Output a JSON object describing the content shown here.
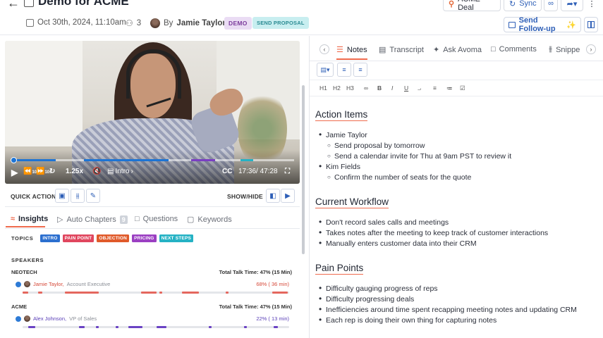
{
  "header": {
    "title": "Demo for ACME",
    "date": "Oct 30th, 2024, 11:10am",
    "attendees": "3",
    "by": "By",
    "owner": "Jamie Taylor",
    "badge_demo": "DEMO",
    "badge_stage": "SEND PROPOSAL",
    "deal_button": "ACME Deal",
    "sync_button": "Sync",
    "followup_button": "Send Follow-up"
  },
  "player": {
    "speed": "1.25x",
    "chapter": "Intro",
    "skip_back": "10s",
    "skip_fwd": "10s",
    "time": "17:36/ 47:28",
    "cc": "CC",
    "progress": 0.01
  },
  "quick_actions": {
    "quick_action_label": "QUICK ACTION",
    "show_hide_label": "SHOW/HIDE"
  },
  "left_tabs": [
    {
      "label": "Insights"
    },
    {
      "label": "Auto Chapters",
      "count": "9"
    },
    {
      "label": "Questions"
    },
    {
      "label": "Keywords"
    }
  ],
  "topics": {
    "label": "TOPICS",
    "items": [
      {
        "label": "INTRO",
        "color": "#2b6fcf"
      },
      {
        "label": "PAIN POINT",
        "color": "#e0465e"
      },
      {
        "label": "OBJECTION",
        "color": "#e05a2a"
      },
      {
        "label": "PRICING",
        "color": "#9b3fc2"
      },
      {
        "label": "NEXT STEPS",
        "color": "#25b2c4"
      }
    ]
  },
  "speakers": {
    "label": "SPEAKERS",
    "groups": [
      {
        "org": "NEOTECH",
        "total": "Total Talk Time: 47% (15 Min)",
        "name": "Jamie Taylor,",
        "role": "Account Executive",
        "pct": "68% ( 36 min)",
        "color": "#e4675e"
      },
      {
        "org": "ACME",
        "total": "Total Talk Time: 47% (15 Min)",
        "name": "Alex Johnson,",
        "role": "VP of Sales",
        "pct": "22% ( 13 min)",
        "color": "#6a43c4"
      }
    ]
  },
  "right_tabs": [
    {
      "label": "Notes"
    },
    {
      "label": "Transcript"
    },
    {
      "label": "Ask Avoma"
    },
    {
      "label": "Comments"
    },
    {
      "label": "Snippe"
    }
  ],
  "format_bar": [
    "H1",
    "H2",
    "H3",
    "B",
    "I",
    "U"
  ],
  "notes": {
    "sections": [
      {
        "heading": "Action Items",
        "items": [
          {
            "text": "Jamie Taylor",
            "level": 1
          },
          {
            "text": "Send proposal by tomorrow",
            "level": 2
          },
          {
            "text": "Send a calendar invite for Thu at 9am PST to review it",
            "level": 2
          },
          {
            "text": "Kim Fields",
            "level": 1
          },
          {
            "text": "Confirm the number of seats for the quote",
            "level": 2
          }
        ]
      },
      {
        "heading": "Current Workflow",
        "items": [
          {
            "text": "Don't record sales calls and meetings",
            "level": 1
          },
          {
            "text": "Takes notes after the meeting to keep track of customer interactions",
            "level": 1
          },
          {
            "text": "Manually enters customer data into their CRM",
            "level": 1
          }
        ]
      },
      {
        "heading": "Pain Points",
        "items": [
          {
            "text": "Difficulty gauging progress of reps",
            "level": 1
          },
          {
            "text": "Difficulty progressing deals",
            "level": 1
          },
          {
            "text": "Inefficiencies around time spent recapping meeting notes and updating CRM",
            "level": 1
          },
          {
            "text": "Each rep is doing their own thing for capturing notes",
            "level": 1
          }
        ]
      }
    ]
  }
}
